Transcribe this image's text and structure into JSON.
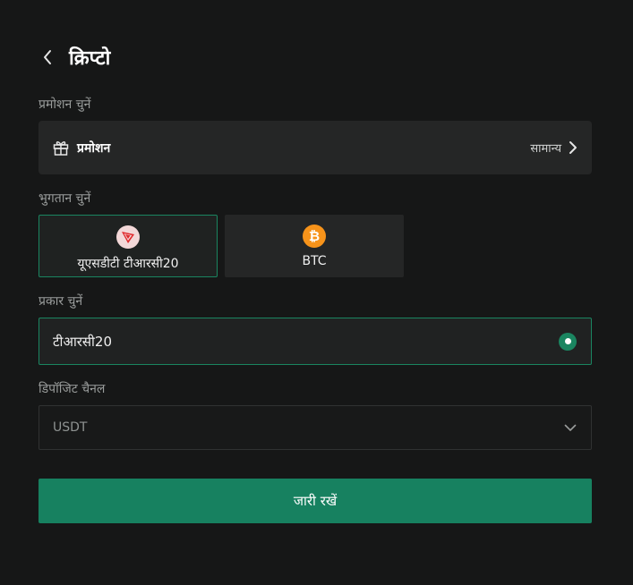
{
  "header": {
    "title": "क्रिप्टो"
  },
  "promotion": {
    "section_label": "प्रमोशन चुनें",
    "row_label": "प्रमोशन",
    "value": "सामान्य"
  },
  "payment": {
    "section_label": "भुगतान चुनें",
    "options": [
      {
        "label": "यूएसडीटी टीआरसी20",
        "icon": "tron-coin-icon",
        "selected": true
      },
      {
        "label": "BTC",
        "icon": "bitcoin-coin-icon",
        "selected": false
      }
    ]
  },
  "type": {
    "section_label": "प्रकार चुनें",
    "option_label": "टीआरसी20",
    "selected": true
  },
  "deposit_channel": {
    "section_label": "डिपॉजिट चैनल",
    "value": "USDT"
  },
  "actions": {
    "continue_label": "जारी रखें"
  },
  "colors": {
    "background": "#161717",
    "card": "#252626",
    "accent": "#178160",
    "btc": "#f7931a",
    "tron": "#e0282b"
  }
}
